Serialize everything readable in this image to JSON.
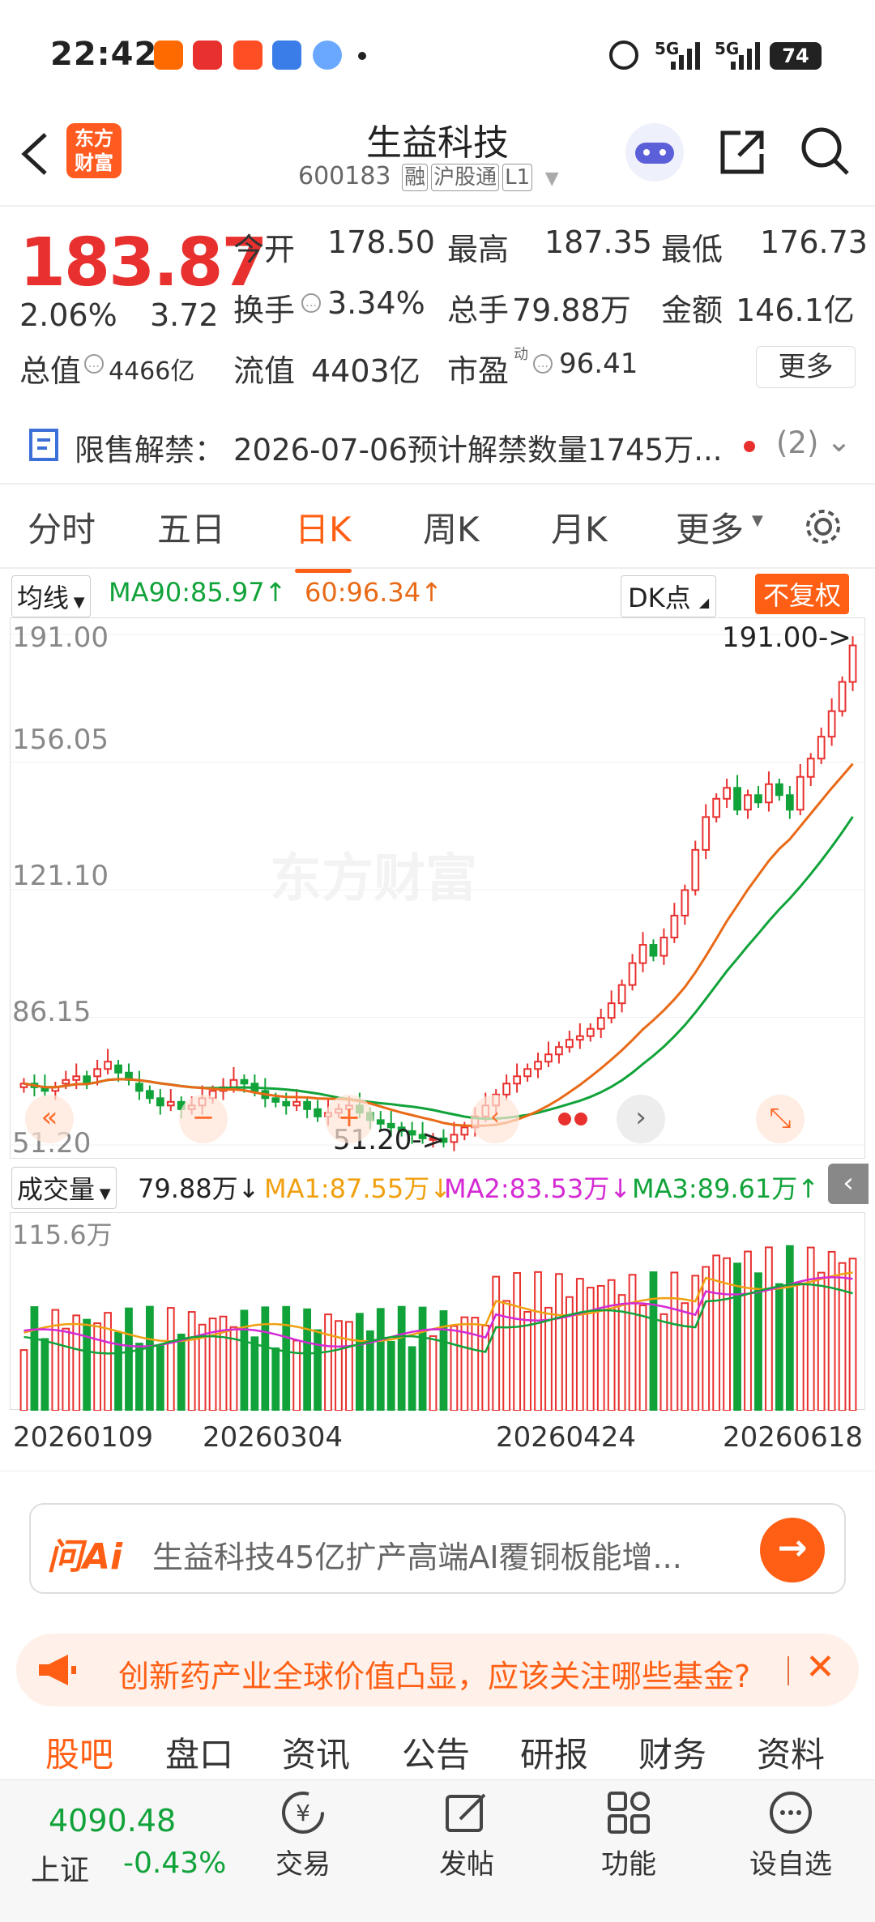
{
  "status_bar": {
    "time": "22:42",
    "battery": "74",
    "signal1": "5G",
    "signal2": "5G"
  },
  "header": {
    "title": "生益科技",
    "code": "600183",
    "tags": [
      "融",
      "沪股通",
      "L1"
    ],
    "logo_line1": "东方",
    "logo_line2": "财富"
  },
  "quote": {
    "price": "183.87",
    "change_pct": "2.06%",
    "change": "3.72",
    "open_label": "今开",
    "open": "178.50",
    "high_label": "最高",
    "high": "187.35",
    "low_label": "最低",
    "low": "176.73",
    "turnover_label": "换手",
    "turnover": "3.34%",
    "volume_label": "总手",
    "volume": "79.88万",
    "amount_label": "金额",
    "amount": "146.1亿",
    "mktcap_label": "总值",
    "mktcap": "4466亿",
    "float_label": "流值",
    "float_cap": "4403亿",
    "pe_label": "市盈",
    "pe_sup": "动",
    "pe": "96.41",
    "more": "更多"
  },
  "notice": {
    "label": "限售解禁：",
    "text": "2026-07-06预计解禁数量1745万...",
    "count": "(2)"
  },
  "tabs": [
    {
      "label": "分时"
    },
    {
      "label": "五日"
    },
    {
      "label": "日K"
    },
    {
      "label": "周K"
    },
    {
      "label": "月K"
    },
    {
      "label": "更多"
    }
  ],
  "chart_toolbar": {
    "indicator": "均线",
    "ma90": "MA90:85.97↑",
    "ma60": "60:96.34↑",
    "dk": "DK点",
    "adjust": "不复权"
  },
  "chart_data": {
    "type": "candlestick",
    "y_ticks": [
      "191.00",
      "156.05",
      "121.10",
      "86.15",
      "51.20"
    ],
    "ylim": [
      51.2,
      191.0
    ],
    "max_marker": "191.00->",
    "min_marker": "51.20->",
    "closes": [
      68,
      67,
      66,
      67,
      69,
      70,
      68,
      72,
      74,
      71,
      69,
      66,
      64,
      62,
      63,
      61,
      62,
      64,
      66,
      67,
      69,
      68,
      66,
      64,
      63,
      62,
      63,
      61,
      59,
      60,
      61,
      62,
      60,
      58,
      57,
      56,
      55,
      54,
      53,
      53,
      52,
      54,
      56,
      59,
      62,
      65,
      68,
      70,
      72,
      74,
      76,
      78,
      80,
      81,
      83,
      86,
      90,
      95,
      101,
      106,
      103,
      108,
      114,
      121,
      132,
      141,
      146,
      149,
      143,
      147,
      145,
      150,
      147,
      143,
      152,
      157,
      163,
      170,
      178,
      188
    ],
    "opens": [
      67,
      68,
      67,
      66,
      68,
      69,
      70,
      70,
      72,
      73,
      71,
      68,
      66,
      64,
      62,
      63,
      61,
      62,
      64,
      66,
      67,
      69,
      68,
      66,
      64,
      63,
      62,
      63,
      61,
      59,
      60,
      61,
      62,
      60,
      58,
      57,
      56,
      55,
      54,
      53,
      53,
      52,
      54,
      56,
      59,
      62,
      65,
      68,
      70,
      72,
      74,
      76,
      78,
      80,
      81,
      83,
      86,
      90,
      95,
      101,
      106,
      103,
      108,
      114,
      121,
      132,
      141,
      146,
      149,
      143,
      147,
      145,
      150,
      147,
      143,
      152,
      157,
      163,
      170,
      178
    ]
  },
  "volume_toolbar": {
    "label": "成交量",
    "vol": "79.88万↓",
    "ma1": "MA1:87.55万↓",
    "ma2": "MA2:83.53万↓",
    "ma3": "MA3:89.61万↑"
  },
  "volume_chart": {
    "top_label": "115.6万"
  },
  "x_labels": [
    "20260109",
    "20260304",
    "20260424",
    "20260618"
  ],
  "ask_ai": {
    "brand": "问Ai",
    "text": "生益科技45亿扩产高端AI覆铜板能增..."
  },
  "promo": {
    "text": "创新药产业全球价值凸显，应该关注哪些基金?"
  },
  "subtabs": [
    "股吧",
    "盘口",
    "资讯",
    "公告",
    "研报",
    "财务",
    "资料"
  ],
  "bottom_nav": {
    "index_value": "4090.48",
    "index_name": "上证",
    "index_change": "-0.43%",
    "items": [
      {
        "label": "交易"
      },
      {
        "label": "发帖"
      },
      {
        "label": "功能"
      },
      {
        "label": "设自选"
      }
    ]
  },
  "colors": {
    "up": "#e8312f",
    "down": "#11a33a",
    "accent": "#ff5f14"
  }
}
